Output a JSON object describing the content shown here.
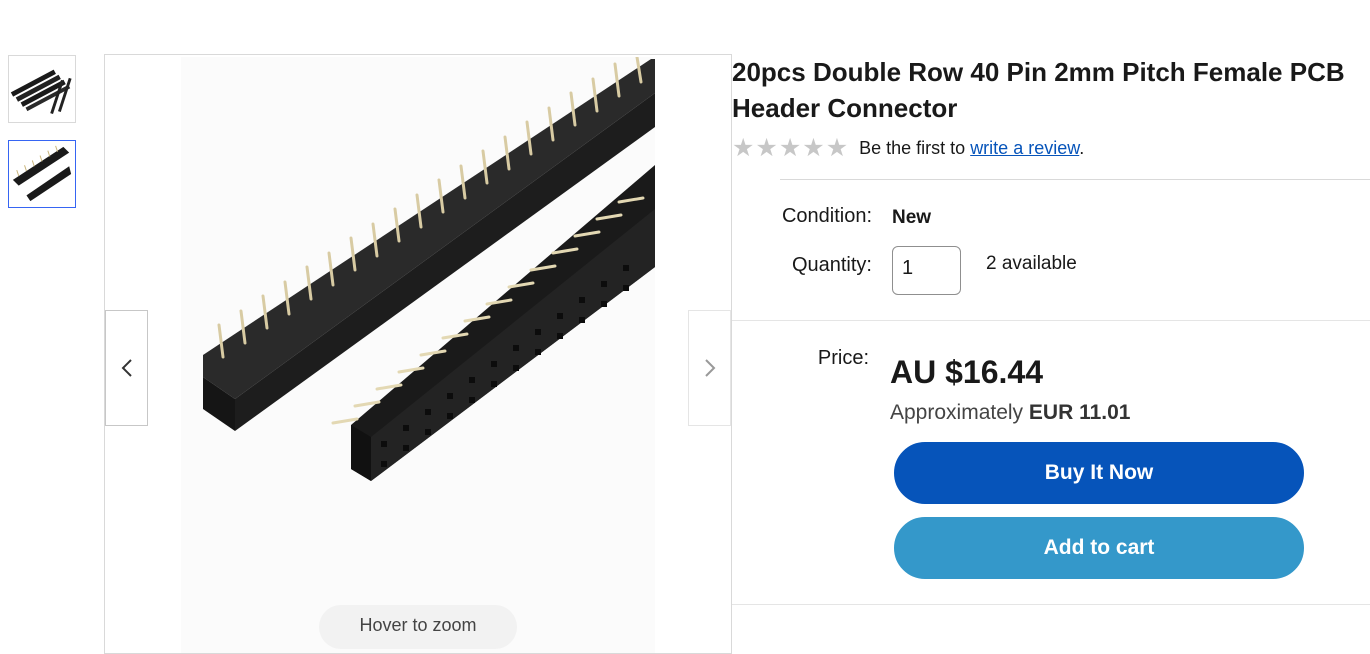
{
  "gallery": {
    "thumbnails": [
      "product-thumbnail-1",
      "product-thumbnail-2"
    ],
    "selected_thumbnail": 2,
    "zoom_hint": "Hover to zoom",
    "prev_icon": "chevron-left-icon",
    "next_icon": "chevron-right-icon"
  },
  "product": {
    "title": "20pcs Double Row 40 Pin 2mm Pitch Female PCB Header Connector",
    "rating": {
      "stars_filled": 0,
      "stars_total": 5,
      "prefix": "Be the first to",
      "link": "write a review",
      "suffix": "."
    },
    "condition_label": "Condition:",
    "condition_value": "New",
    "quantity_label": "Quantity:",
    "quantity_value": "1",
    "available": "2 available",
    "price_label": "Price:",
    "price": "AU $16.44",
    "approx_prefix": "Approximately",
    "approx_value": "EUR 11.01"
  },
  "actions": {
    "buy_now": "Buy It Now",
    "add_to_cart": "Add to cart"
  },
  "colors": {
    "buy_now_bg": "#0654ba",
    "add_to_cart_bg": "#3498ca",
    "link": "#0654ba",
    "star_empty": "#c7c7c7"
  }
}
